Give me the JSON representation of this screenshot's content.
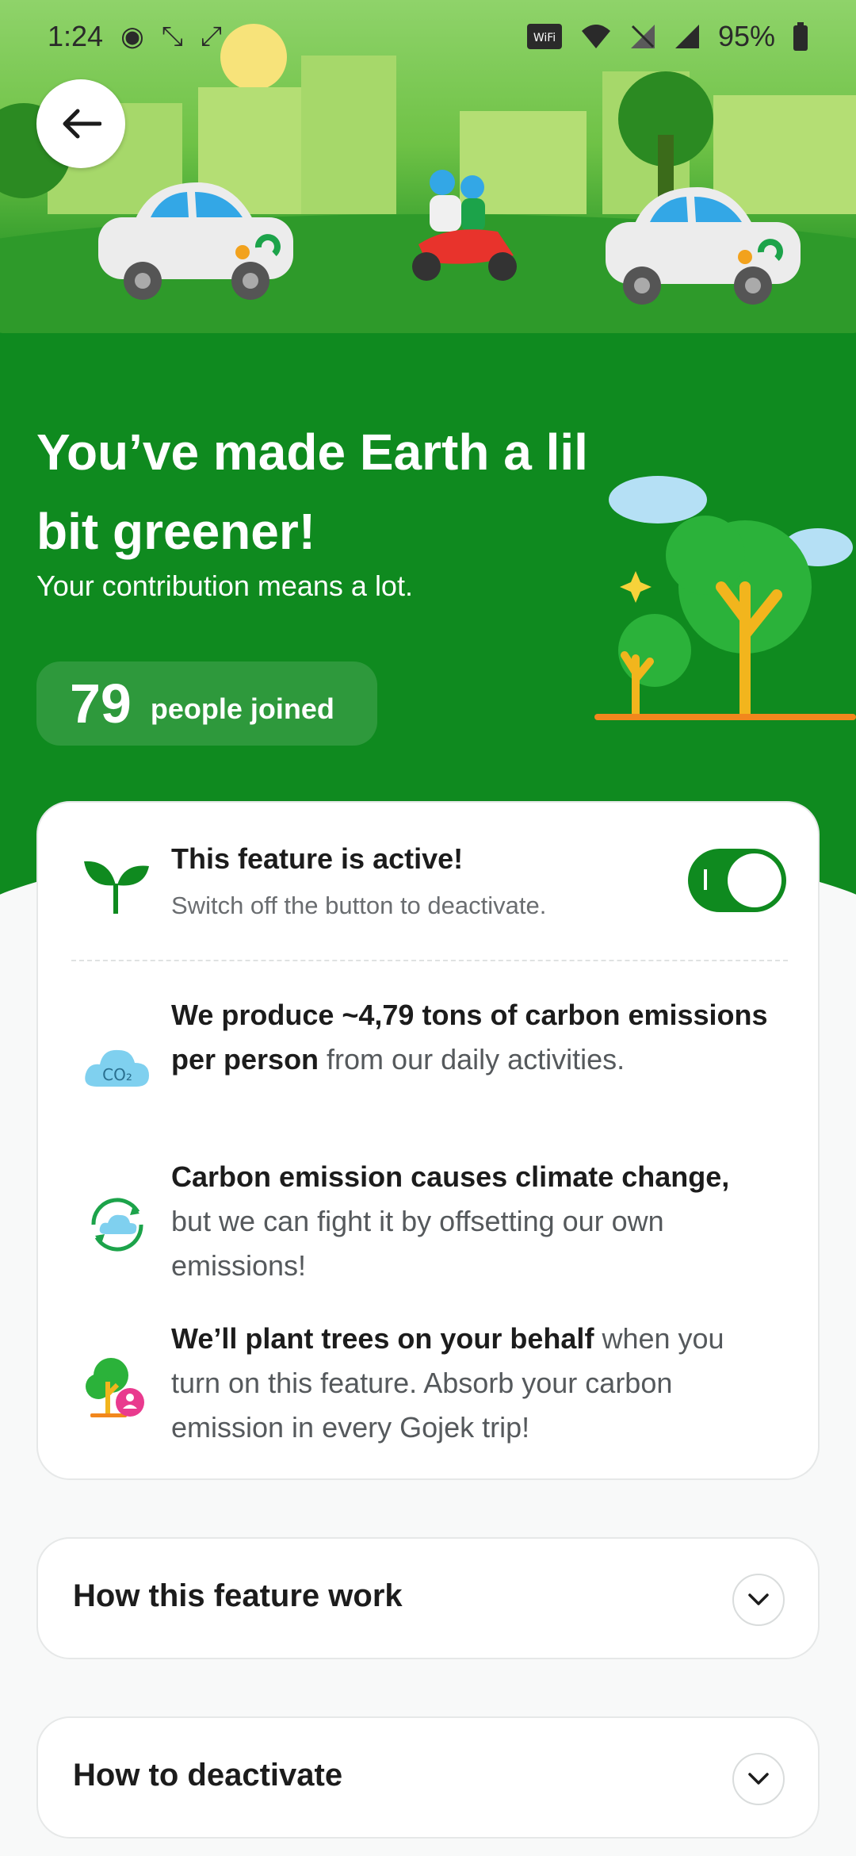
{
  "status_bar": {
    "time": "1:24",
    "battery": "95%",
    "vowifi": "Vo WiFi"
  },
  "hero": {
    "title": "You’ve made Earth a lil bit greener!",
    "subtitle": "Your contribution means a lot.",
    "joined_count": "79",
    "joined_label": "people joined"
  },
  "feature": {
    "title": "This feature is active!",
    "subtitle": "Switch off the button to deactivate.",
    "toggle_on": true
  },
  "facts": [
    {
      "icon": "co2-cloud-icon",
      "bold": "We produce ~4,79 tons of carbon emissions per person",
      "rest": " from our daily activities."
    },
    {
      "icon": "recycle-cloud-icon",
      "bold": "Carbon emission causes climate change,",
      "rest": " but we can fight it by offsetting our own emissions!"
    },
    {
      "icon": "tree-person-icon",
      "bold": "We’ll plant trees on your behalf",
      "rest": " when you turn on this feature. Absorb your carbon emission in every Gojek trip!"
    }
  ],
  "accordions": [
    {
      "label": "How this feature work"
    },
    {
      "label": "How to deactivate"
    }
  ],
  "colors": {
    "brand_green": "#0f8a1f",
    "text_dark": "#1c1c1c",
    "text_muted": "#6a6d70"
  }
}
